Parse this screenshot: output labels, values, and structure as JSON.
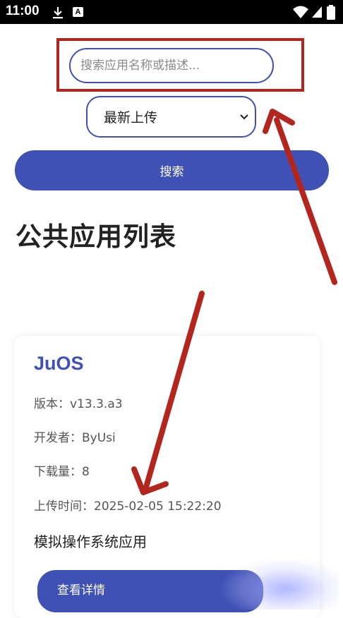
{
  "status_bar": {
    "time": "11:00",
    "icons": [
      "download-icon",
      "a-icon",
      "wifi-icon",
      "signal-icon",
      "battery-icon"
    ]
  },
  "search": {
    "placeholder": "搜索应用名称或描述...",
    "value": ""
  },
  "sort": {
    "selected": "最新上传"
  },
  "search_button": {
    "label": "搜索"
  },
  "page_title": "公共应用列表",
  "apps": [
    {
      "name": "JuOS",
      "version": "版本：v13.3.a3",
      "developer": "开发者：ByUsi",
      "downloads": "下载量：8",
      "upload_time": "上传时间：2025-02-05 15:22:20",
      "description": "模拟操作系统应用",
      "details_label": "查看详情"
    }
  ],
  "colors": {
    "primary": "#3f51b5",
    "annotation": "#b3261e",
    "status_bar": "#000000"
  }
}
